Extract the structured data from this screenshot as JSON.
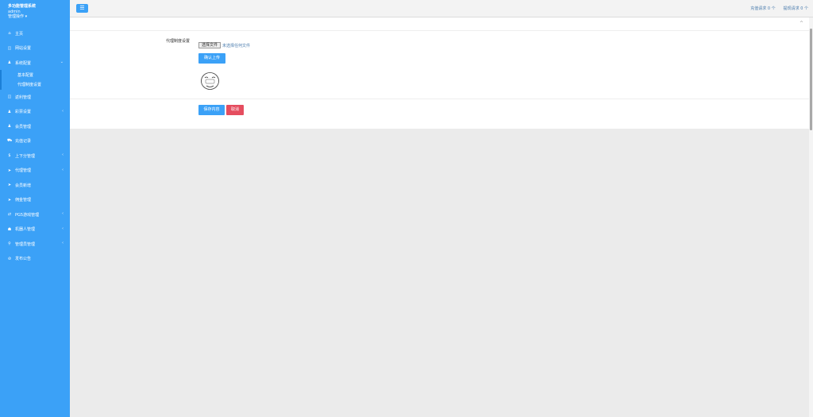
{
  "brand": {
    "title": "多功能管理系统",
    "user": "admin",
    "operation": "管理操作 ▾"
  },
  "sidebar": {
    "items": [
      {
        "label": "主页",
        "icon": "home-icon",
        "glyph": "⌂",
        "chevron": ""
      },
      {
        "label": "网站设置",
        "icon": "window-icon",
        "glyph": "◫",
        "chevron": ""
      },
      {
        "label": "系统配置",
        "icon": "user-icon",
        "glyph": "♟",
        "chevron": "⌄"
      },
      {
        "label": "返利管理",
        "icon": "window-icon",
        "glyph": "◫",
        "chevron": ""
      },
      {
        "label": "彩票设置",
        "icon": "user-icon",
        "glyph": "♟",
        "chevron": "‹"
      },
      {
        "label": "会员管理",
        "icon": "user-icon",
        "glyph": "♟",
        "chevron": ""
      },
      {
        "label": "充值记录",
        "icon": "car-icon",
        "glyph": "⛟",
        "chevron": ""
      },
      {
        "label": "上下分管理",
        "icon": "dollar-icon",
        "glyph": "$",
        "chevron": "‹"
      },
      {
        "label": "代理管理",
        "icon": "send-icon",
        "glyph": "➤",
        "chevron": "‹"
      },
      {
        "label": "会员新增",
        "icon": "send-icon",
        "glyph": "➤",
        "chevron": ""
      },
      {
        "label": "佣金管理",
        "icon": "send-icon",
        "glyph": "➤",
        "chevron": ""
      },
      {
        "label": "PG5游戏管理",
        "icon": "exchange-icon",
        "glyph": "⇄",
        "chevron": "‹"
      },
      {
        "label": "机器人管理",
        "icon": "robot-icon",
        "glyph": "☗",
        "chevron": "‹"
      },
      {
        "label": "管理员管理",
        "icon": "pin-icon",
        "glyph": "⚲",
        "chevron": "‹"
      },
      {
        "label": "发布公告",
        "icon": "link-icon",
        "glyph": "⊘",
        "chevron": ""
      }
    ],
    "subitems": [
      "基本配置",
      "代理制度设置"
    ]
  },
  "topbar": {
    "menu_glyph": "☰",
    "recharge_requests": "充值请求 0 个",
    "withdraw_requests": "提现请求 0 个"
  },
  "form": {
    "label": "代理制度设置",
    "choose_file": "选择文件",
    "file_status": "未选择任何文件",
    "upload": "确认上传",
    "save": "保存内容",
    "cancel": "取消",
    "collapse_glyph": "^"
  },
  "colors": {
    "sidebar": "#3ba1f7",
    "primary": "#3ba1f7",
    "danger": "#e54d5f",
    "link": "#4a7cad"
  }
}
